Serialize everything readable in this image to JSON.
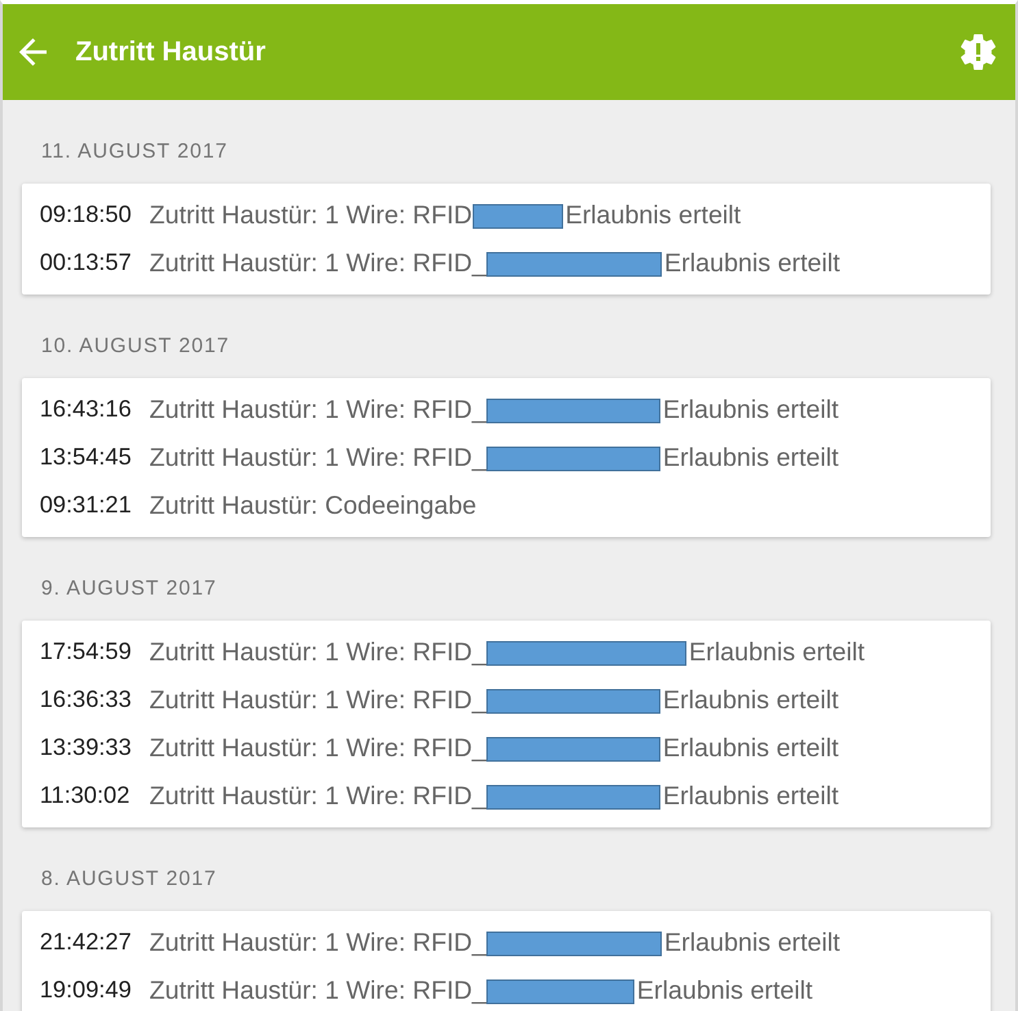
{
  "app_bar": {
    "title": "Zutritt Haustür"
  },
  "days": [
    {
      "date": "11. AUGUST 2017",
      "entries": [
        {
          "time": "09:18:50",
          "kind": "redacted",
          "text_before": "Zutritt Haustür: 1 Wire: RFID",
          "text_after": "Erlaubnis erteilt"
        },
        {
          "time": "00:13:57",
          "kind": "redacted",
          "text_before": "Zutritt Haustür: 1 Wire: RFID_",
          "text_after": "Erlaubnis erteilt"
        }
      ]
    },
    {
      "date": "10. AUGUST 2017",
      "entries": [
        {
          "time": "16:43:16",
          "kind": "redacted",
          "text_before": "Zutritt Haustür: 1 Wire: RFID_",
          "text_after": "Erlaubnis erteilt"
        },
        {
          "time": "13:54:45",
          "kind": "redacted",
          "text_before": "Zutritt Haustür: 1 Wire: RFID_",
          "text_after": "Erlaubnis erteilt"
        },
        {
          "time": "09:31:21",
          "kind": "plain",
          "text_before": "Zutritt Haustür: Codeeingabe"
        }
      ]
    },
    {
      "date": "9. AUGUST 2017",
      "entries": [
        {
          "time": "17:54:59",
          "kind": "redacted",
          "text_before": "Zutritt Haustür: 1 Wire: RFID_",
          "text_after": "Erlaubnis erteilt"
        },
        {
          "time": "16:36:33",
          "kind": "redacted",
          "text_before": "Zutritt Haustür: 1 Wire: RFID_",
          "text_after": "Erlaubnis erteilt"
        },
        {
          "time": "13:39:33",
          "kind": "redacted",
          "text_before": "Zutritt Haustür: 1 Wire: RFID_",
          "text_after": "Erlaubnis erteilt"
        },
        {
          "time": "11:30:02",
          "kind": "redacted",
          "text_before": "Zutritt Haustür: 1 Wire: RFID_",
          "text_after": "Erlaubnis erteilt"
        }
      ]
    },
    {
      "date": "8. AUGUST 2017",
      "entries": [
        {
          "time": "21:42:27",
          "kind": "redacted",
          "text_before": "Zutritt Haustür: 1 Wire: RFID_",
          "text_after": "Erlaubnis erteilt"
        },
        {
          "time": "19:09:49",
          "kind": "redacted",
          "text_before": "Zutritt Haustür: 1 Wire: RFID_",
          "text_after": "Erlaubnis erteilt"
        }
      ]
    }
  ]
}
